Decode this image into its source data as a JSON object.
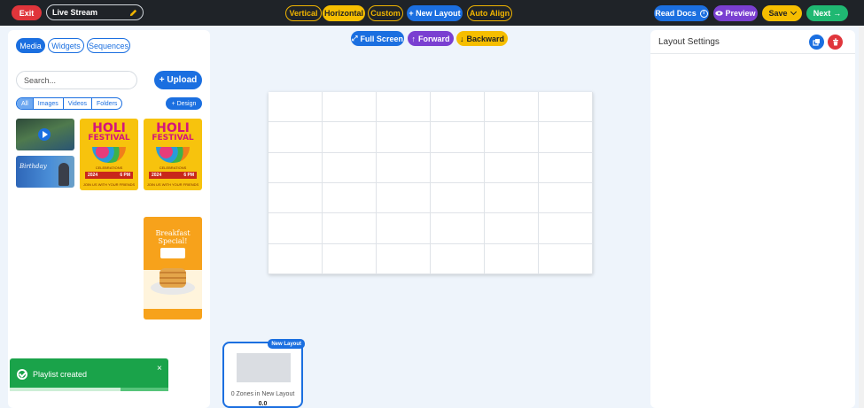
{
  "topbar": {
    "exit_label": "Exit",
    "layout_name": "Live Stream",
    "orientation": [
      "Vertical",
      "Horizontal",
      "Custom"
    ],
    "new_layout_label": "+ New Layout",
    "auto_align_label": "Auto Align",
    "read_docs_label": "Read Docs",
    "preview_label": "Preview",
    "save_label": "Save",
    "next_label": "Next"
  },
  "left": {
    "tabs": [
      "Media",
      "Widgets",
      "Sequences"
    ],
    "search_placeholder": "Search...",
    "upload_label": "+ Upload",
    "filters": [
      "All",
      "Images",
      "Videos",
      "Folders"
    ],
    "design_label": "+ Design",
    "holi": {
      "title_1": "HOLI",
      "title_2": "FESTIVAL",
      "celebrations": "CELEBRATIONS",
      "year": "2024",
      "time": "6 PM",
      "footer": "JOIN US WITH YOUR FRIENDS"
    },
    "birthday_text": "Birthday",
    "breakfast_title": "Breakfast Special!"
  },
  "toast": {
    "message": "Playlist created",
    "close": "×",
    "progress": 0.7
  },
  "canvas": {
    "full_screen_label": "Full Screen",
    "forward_label": "Forward",
    "backward_label": "Backward"
  },
  "layout_card": {
    "badge": "New Layout",
    "zones_text": "0 Zones in New Layout",
    "duration": "0.0"
  },
  "right": {
    "title": "Layout Settings"
  },
  "colors": {
    "primary": "#1b6fe0",
    "danger": "#e0353b",
    "warning": "#f6be00",
    "purple": "#7a3fd1",
    "success": "#1fb872"
  }
}
